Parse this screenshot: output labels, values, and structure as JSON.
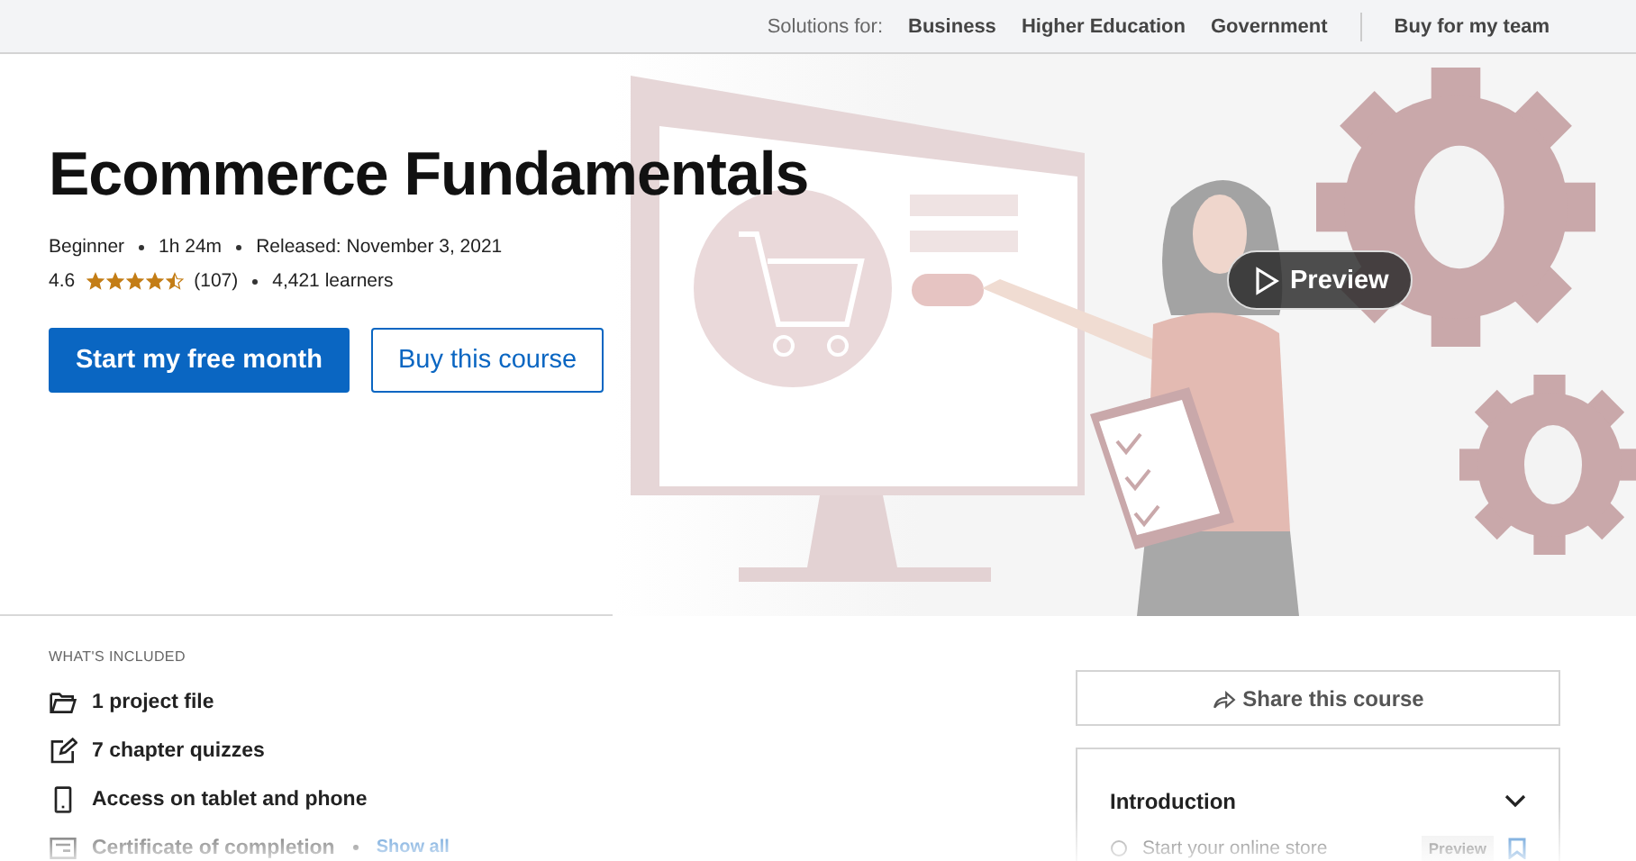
{
  "top_bar": {
    "label": "Solutions for:",
    "links": [
      "Business",
      "Higher Education",
      "Government"
    ],
    "cta": "Buy for my team"
  },
  "course": {
    "title": "Ecommerce Fundamentals",
    "meta": [
      "Beginner",
      "1h 24m",
      "Released: November 3, 2021"
    ],
    "rating": "4.6",
    "stars": 4.5,
    "reviews": "(107)",
    "learners": "4,421 learners"
  },
  "buttons": [
    {
      "label": "Start my free month",
      "kind": "primary"
    },
    {
      "label": "Buy this course",
      "kind": "secondary"
    }
  ],
  "preview_button": "Preview",
  "included": {
    "heading": "WHAT'S INCLUDED",
    "items": [
      {
        "kind": "folder",
        "label": "1 project file"
      },
      {
        "kind": "quiz",
        "label": "7 chapter quizzes"
      },
      {
        "kind": "phone",
        "label": "Access on tablet and phone"
      },
      {
        "kind": "certificate",
        "label": "Certificate of completion"
      }
    ],
    "show_all": "Show all"
  },
  "share_button": "Share this course",
  "contents": {
    "chapter": "Introduction",
    "expanded": true,
    "videos": [
      {
        "title": "Start your online store",
        "badge": "Preview",
        "watched": false,
        "saved": false
      }
    ]
  }
}
